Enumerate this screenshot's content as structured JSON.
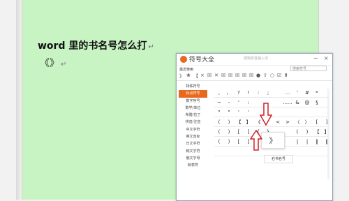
{
  "document": {
    "title": "word 里的书名号怎么打",
    "para_mark": "↵",
    "marks": "《》",
    "marks_para": "↵"
  },
  "window": {
    "title": "符号大全",
    "search_hint": "搜狗拼音输入法",
    "minimize": "−",
    "close": "×",
    "recent_label": "最近使用",
    "search_placeholder": "搜索符号",
    "toolbar_row": [
      "》",
      "❀",
      "【",
      "×",
      "☒",
      "✕",
      "☒",
      "☒",
      "☒",
      "☒",
      "☒",
      "●",
      "⇧",
      "○",
      "☑",
      "⬆"
    ]
  },
  "sidebar": {
    "items": [
      "特殊符号",
      "标点符号",
      "数字序号",
      "数学/单位",
      "希腊/拉丁",
      "拼音/注音",
      "中文字符",
      "英文音标",
      "日文字符",
      "韩文字符",
      "俄文字母",
      "制表符"
    ],
    "active_index": 1
  },
  "symbols": {
    "rows": [
      [
        ",",
        "、",
        "?",
        "!",
        ":",
        ";",
        "",
        "...",
        "'",
        "#",
        "*"
      ],
      [
        "~",
        "-",
        "'",
        ":",
        "",
        "",
        "",
        "......",
        "&",
        "@",
        "§"
      ],
      [
        "\"",
        "\"",
        "'",
        "'",
        "",
        "",
        "",
        "",
        "",
        "",
        ""
      ],
      [
        "(",
        ")",
        "【",
        "】",
        "《",
        "》",
        "<",
        ">",
        "〈",
        "〉",
        "[",
        "]"
      ],
      [
        "(",
        ")",
        "[",
        "]",
        "{",
        "}",
        "",
        "",
        "(",
        ")",
        "【",
        "】"
      ],
      [
        "(",
        ")",
        "[",
        "]",
        "",
        "",
        "",
        "",
        "|",
        "|",
        "‖",
        "‖"
      ],
      [
        "",
        "",
        "",
        "",
        "",
        "",
        "",
        "",
        "",
        "",
        "",
        ""
      ]
    ]
  },
  "popup": {
    "char": "》",
    "label": "右书名号"
  },
  "colors": {
    "accent": "#e8681c",
    "doc_bg": "#c8f4c4",
    "arrow": "#d0202a"
  }
}
